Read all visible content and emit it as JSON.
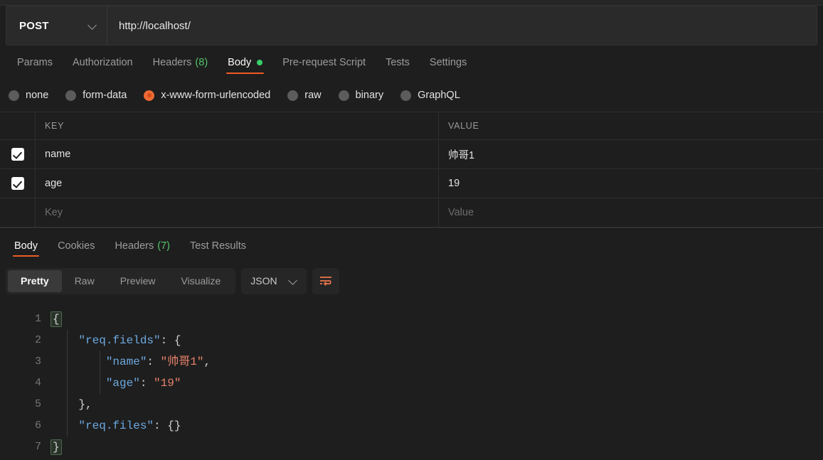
{
  "request": {
    "method": "POST",
    "url": "http://localhost/",
    "tabs": [
      {
        "label": "Params",
        "active": false,
        "count": null,
        "dot": false
      },
      {
        "label": "Authorization",
        "active": false,
        "count": null,
        "dot": false
      },
      {
        "label": "Headers",
        "active": false,
        "count": "(8)",
        "dot": false
      },
      {
        "label": "Body",
        "active": true,
        "count": null,
        "dot": true
      },
      {
        "label": "Pre-request Script",
        "active": false,
        "count": null,
        "dot": false
      },
      {
        "label": "Tests",
        "active": false,
        "count": null,
        "dot": false
      },
      {
        "label": "Settings",
        "active": false,
        "count": null,
        "dot": false
      }
    ],
    "body_types": [
      {
        "label": "none",
        "selected": false
      },
      {
        "label": "form-data",
        "selected": false
      },
      {
        "label": "x-www-form-urlencoded",
        "selected": true
      },
      {
        "label": "raw",
        "selected": false
      },
      {
        "label": "binary",
        "selected": false
      },
      {
        "label": "GraphQL",
        "selected": false
      }
    ],
    "table": {
      "columns": [
        "KEY",
        "VALUE"
      ],
      "rows": [
        {
          "checked": true,
          "key": "name",
          "value": "帅哥1"
        },
        {
          "checked": true,
          "key": "age",
          "value": "19"
        }
      ],
      "placeholder_row": {
        "key": "Key",
        "value": "Value"
      }
    }
  },
  "response": {
    "tabs": [
      {
        "label": "Body",
        "active": true,
        "count": null
      },
      {
        "label": "Cookies",
        "active": false,
        "count": null
      },
      {
        "label": "Headers",
        "active": false,
        "count": "(7)"
      },
      {
        "label": "Test Results",
        "active": false,
        "count": null
      }
    ],
    "view_modes": [
      {
        "label": "Pretty",
        "active": true
      },
      {
        "label": "Raw",
        "active": false
      },
      {
        "label": "Preview",
        "active": false
      },
      {
        "label": "Visualize",
        "active": false
      }
    ],
    "format": "JSON",
    "wrap_icon": "word-wrap-icon",
    "code_lines": [
      {
        "n": "1",
        "text": "{"
      },
      {
        "n": "2",
        "text": "    \"req.fields\": {"
      },
      {
        "n": "3",
        "text": "        \"name\": \"帅哥1\","
      },
      {
        "n": "4",
        "text": "        \"age\": \"19\""
      },
      {
        "n": "5",
        "text": "    },"
      },
      {
        "n": "6",
        "text": "    \"req.files\": {}"
      },
      {
        "n": "7",
        "text": "}"
      }
    ]
  },
  "colors": {
    "accent_orange": "#ef5b25",
    "status_green": "#3ad06a",
    "json_key_blue": "#6ca9e0",
    "json_string_orange": "#e8836a",
    "background": "#1e1e1e"
  }
}
